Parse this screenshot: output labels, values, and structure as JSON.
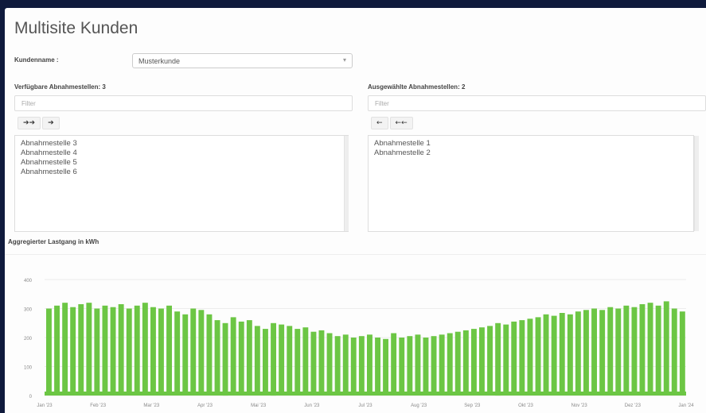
{
  "page": {
    "title": "Multisite Kunden"
  },
  "customer": {
    "label": "Kundenname :",
    "selected": "Musterkunde"
  },
  "available": {
    "label": "Verfügbare Abnahmestellen: 3",
    "filter_placeholder": "Filter",
    "items": [
      "Abnahmestelle 3",
      "Abnahmestelle 4",
      "Abnahmestelle 5",
      "Abnahmestelle 6"
    ],
    "move_all_label": "➔➔",
    "move_one_label": "➔"
  },
  "selected": {
    "label": "Ausgewählte Abnahmestellen: 2",
    "filter_placeholder": "Filter",
    "items": [
      "Abnahmestelle 1",
      "Abnahmestelle 2"
    ],
    "remove_one_label": "←",
    "remove_all_label": "←←"
  },
  "chart": {
    "label": "Aggregierter Lastgang in kWh",
    "color": "#6cc644"
  },
  "chart_data": {
    "type": "area",
    "title": "Aggregierter Lastgang in kWh",
    "xlabel": "",
    "ylabel": "",
    "ylim": [
      0,
      400
    ],
    "yticks": [
      "400",
      "300",
      "200",
      "100",
      "0"
    ],
    "ytick_values": [
      400,
      300,
      200,
      100,
      0
    ],
    "xticks": [
      "Jan '23",
      "Feb '23",
      "Mar '23",
      "Apr '23",
      "Mai '23",
      "Jun '23",
      "Jul '23",
      "Aug '23",
      "Sep '23",
      "Okt '23",
      "Nov '23",
      "Dez '23",
      "Jan '24"
    ],
    "grid": true,
    "series": [
      {
        "values": [
          300,
          310,
          320,
          305,
          315,
          320,
          300,
          310,
          305,
          315,
          300,
          310,
          320,
          305,
          300,
          310,
          290,
          280,
          300,
          295,
          280,
          260,
          250,
          270,
          255,
          260,
          240,
          230,
          250,
          245,
          240,
          230,
          235,
          220,
          225,
          215,
          205,
          210,
          200,
          205,
          210,
          200,
          195,
          215,
          200,
          205,
          210,
          200,
          205,
          210,
          215,
          220,
          225,
          230,
          235,
          240,
          250,
          245,
          255,
          260,
          265,
          270,
          280,
          275,
          285,
          280,
          290,
          295,
          300,
          295,
          305,
          300,
          310,
          305,
          315,
          320,
          310,
          325,
          300,
          290
        ]
      }
    ]
  }
}
